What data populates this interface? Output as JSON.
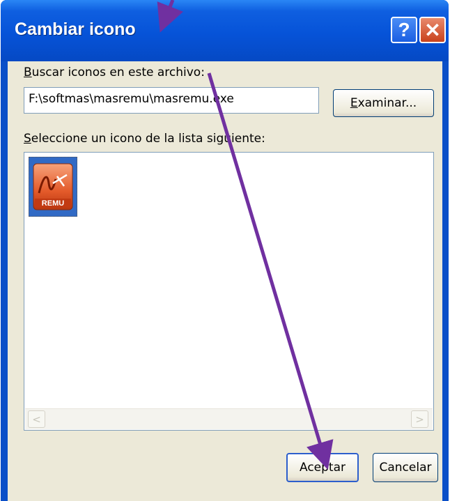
{
  "window": {
    "title": "Cambiar icono",
    "help_glyph": "?",
    "close_glyph": "✕"
  },
  "file_section": {
    "label_hotkey": "B",
    "label_rest": "uscar iconos en este archivo:",
    "path_value": "F:\\softmas\\masremu\\masremu.exe",
    "browse_hotkey": "E",
    "browse_rest": "xaminar..."
  },
  "list_section": {
    "label_hotkey": "S",
    "label_rest": "eleccione un icono de la lista siguiente:",
    "icons": [
      {
        "icon": "masremu-app-icon",
        "caption": "REMU",
        "selected": true
      }
    ],
    "scroll_left": "<",
    "scroll_right": ">"
  },
  "footer": {
    "ok_label": "Aceptar",
    "cancel_label": "Cancelar"
  },
  "colors": {
    "title_bar": "#0653d8",
    "dialog_bg": "#ece9d8",
    "selection": "#316ac5",
    "annotation_arrow": "#7030a0"
  }
}
